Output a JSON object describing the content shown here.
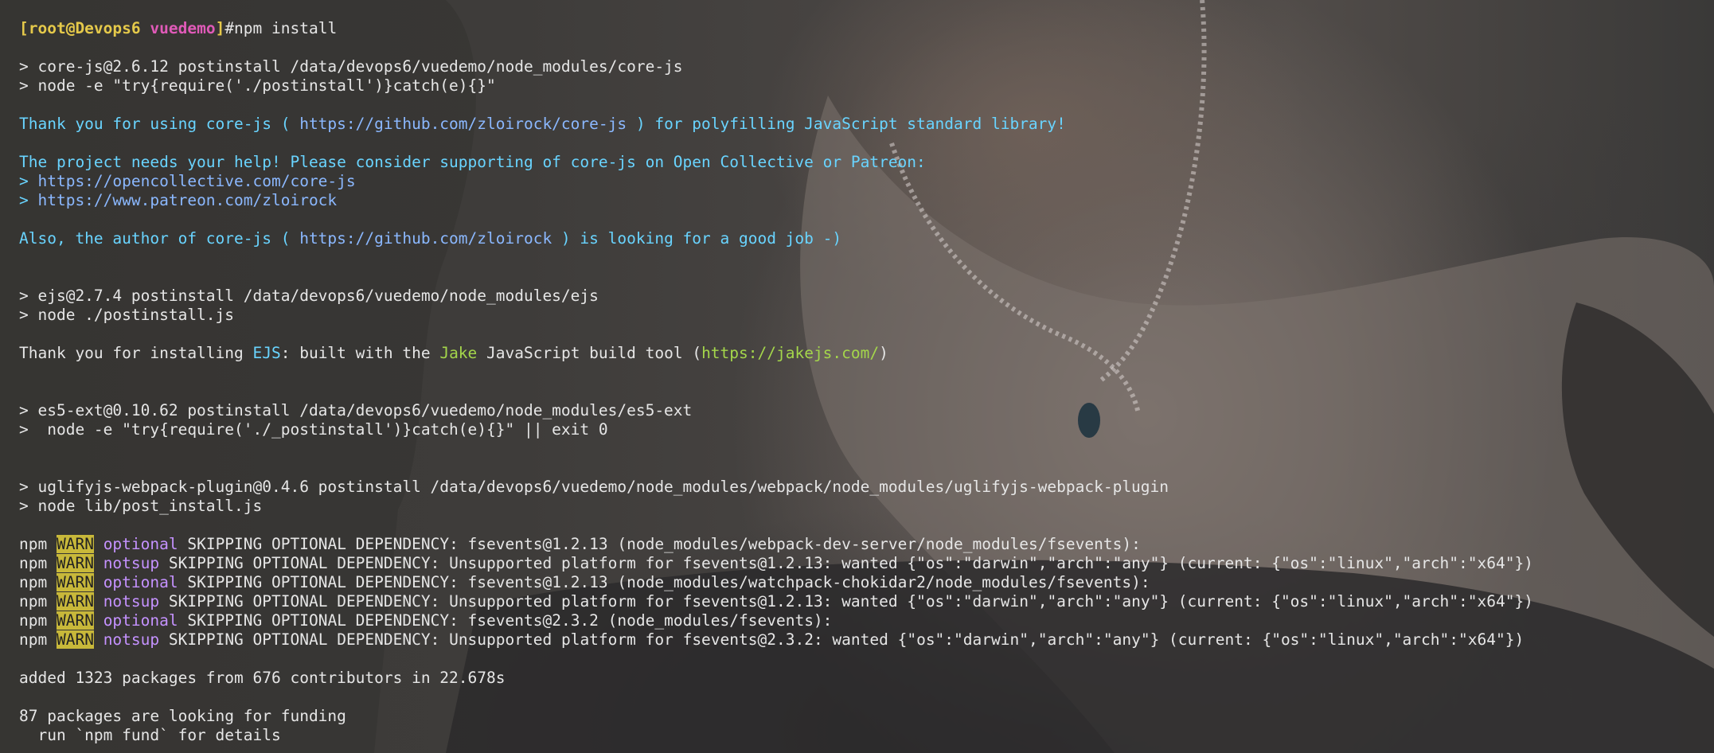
{
  "colors": {
    "prompt_user": "#e5c94a",
    "prompt_dir": "#e05ab8",
    "info_cyan": "#69d4ff",
    "link_blue": "#8bb8ff",
    "warn_bg": "#c8b83a",
    "optional_magenta": "#c592ff",
    "green": "#a4d64b",
    "default": "#e6e6e6"
  },
  "terminal": {
    "lines": [
      {
        "segments": []
      },
      {
        "segments": [
          {
            "cls": "t-bold-yellow",
            "text": "[root@Devops6 "
          },
          {
            "cls": "t-bold-pink",
            "text": "vuedemo"
          },
          {
            "cls": "t-bold-yellow",
            "text": "]"
          },
          {
            "cls": "t-default",
            "text": "#npm install"
          }
        ]
      },
      {
        "segments": []
      },
      {
        "segments": [
          {
            "cls": "t-default",
            "text": "> core-js@2.6.12 postinstall /data/devops6/vuedemo/node_modules/core-js"
          }
        ]
      },
      {
        "segments": [
          {
            "cls": "t-default",
            "text": "> node -e \"try{require('./postinstall')}catch(e){}\""
          }
        ]
      },
      {
        "segments": []
      },
      {
        "segments": [
          {
            "cls": "t-cyan",
            "text": "Thank you for using core-js ( "
          },
          {
            "cls": "t-blue-link",
            "text": "https://github.com/zloirock/core-js"
          },
          {
            "cls": "t-cyan",
            "text": " ) for polyfilling JavaScript standard library!"
          }
        ]
      },
      {
        "segments": []
      },
      {
        "segments": [
          {
            "cls": "t-cyan",
            "text": "The project needs your help! Please consider supporting of core-js on Open Collective or Patreon:"
          }
        ]
      },
      {
        "segments": [
          {
            "cls": "t-cyan",
            "text": "> "
          },
          {
            "cls": "t-blue-link",
            "text": "https://opencollective.com/core-js"
          }
        ]
      },
      {
        "segments": [
          {
            "cls": "t-cyan",
            "text": "> "
          },
          {
            "cls": "t-blue-link",
            "text": "https://www.patreon.com/zloirock"
          }
        ]
      },
      {
        "segments": []
      },
      {
        "segments": [
          {
            "cls": "t-cyan",
            "text": "Also, the author of core-js ( "
          },
          {
            "cls": "t-blue-link",
            "text": "https://github.com/zloirock"
          },
          {
            "cls": "t-cyan",
            "text": " ) is looking for a good job -)"
          }
        ]
      },
      {
        "segments": []
      },
      {
        "segments": []
      },
      {
        "segments": [
          {
            "cls": "t-default",
            "text": "> ejs@2.7.4 postinstall /data/devops6/vuedemo/node_modules/ejs"
          }
        ]
      },
      {
        "segments": [
          {
            "cls": "t-default",
            "text": "> node ./postinstall.js"
          }
        ]
      },
      {
        "segments": []
      },
      {
        "segments": [
          {
            "cls": "t-default",
            "text": "Thank you for installing "
          },
          {
            "cls": "t-cyan",
            "text": "EJS"
          },
          {
            "cls": "t-default",
            "text": ": built with the "
          },
          {
            "cls": "t-green",
            "text": "Jake"
          },
          {
            "cls": "t-default",
            "text": " JavaScript build tool ("
          },
          {
            "cls": "t-green",
            "text": "https://jakejs.com/"
          },
          {
            "cls": "t-default",
            "text": ")"
          }
        ]
      },
      {
        "segments": []
      },
      {
        "segments": []
      },
      {
        "segments": [
          {
            "cls": "t-default",
            "text": "> es5-ext@0.10.62 postinstall /data/devops6/vuedemo/node_modules/es5-ext"
          }
        ]
      },
      {
        "segments": [
          {
            "cls": "t-default",
            "text": ">  node -e \"try{require('./_postinstall')}catch(e){}\" || exit 0"
          }
        ]
      },
      {
        "segments": []
      },
      {
        "segments": []
      },
      {
        "segments": [
          {
            "cls": "t-default",
            "text": "> uglifyjs-webpack-plugin@0.4.6 postinstall /data/devops6/vuedemo/node_modules/webpack/node_modules/uglifyjs-webpack-plugin"
          }
        ]
      },
      {
        "segments": [
          {
            "cls": "t-default",
            "text": "> node lib/post_install.js"
          }
        ]
      },
      {
        "segments": []
      },
      {
        "segments": [
          {
            "cls": "t-default",
            "text": "npm "
          },
          {
            "cls": "t-warn",
            "text": "WARN"
          },
          {
            "cls": "t-default",
            "text": " "
          },
          {
            "cls": "t-magenta",
            "text": "optional"
          },
          {
            "cls": "t-default",
            "text": " SKIPPING OPTIONAL DEPENDENCY: fsevents@1.2.13 (node_modules/webpack-dev-server/node_modules/fsevents):"
          }
        ]
      },
      {
        "segments": [
          {
            "cls": "t-default",
            "text": "npm "
          },
          {
            "cls": "t-warn",
            "text": "WARN"
          },
          {
            "cls": "t-default",
            "text": " "
          },
          {
            "cls": "t-magenta",
            "text": "notsup"
          },
          {
            "cls": "t-default",
            "text": " SKIPPING OPTIONAL DEPENDENCY: Unsupported platform for fsevents@1.2.13: wanted {\"os\":\"darwin\",\"arch\":\"any\"} (current: {\"os\":\"linux\",\"arch\":\"x64\"})"
          }
        ]
      },
      {
        "segments": [
          {
            "cls": "t-default",
            "text": "npm "
          },
          {
            "cls": "t-warn",
            "text": "WARN"
          },
          {
            "cls": "t-default",
            "text": " "
          },
          {
            "cls": "t-magenta",
            "text": "optional"
          },
          {
            "cls": "t-default",
            "text": " SKIPPING OPTIONAL DEPENDENCY: fsevents@1.2.13 (node_modules/watchpack-chokidar2/node_modules/fsevents):"
          }
        ]
      },
      {
        "segments": [
          {
            "cls": "t-default",
            "text": "npm "
          },
          {
            "cls": "t-warn",
            "text": "WARN"
          },
          {
            "cls": "t-default",
            "text": " "
          },
          {
            "cls": "t-magenta",
            "text": "notsup"
          },
          {
            "cls": "t-default",
            "text": " SKIPPING OPTIONAL DEPENDENCY: Unsupported platform for fsevents@1.2.13: wanted {\"os\":\"darwin\",\"arch\":\"any\"} (current: {\"os\":\"linux\",\"arch\":\"x64\"})"
          }
        ]
      },
      {
        "segments": [
          {
            "cls": "t-default",
            "text": "npm "
          },
          {
            "cls": "t-warn",
            "text": "WARN"
          },
          {
            "cls": "t-default",
            "text": " "
          },
          {
            "cls": "t-magenta",
            "text": "optional"
          },
          {
            "cls": "t-default",
            "text": " SKIPPING OPTIONAL DEPENDENCY: fsevents@2.3.2 (node_modules/fsevents):"
          }
        ]
      },
      {
        "segments": [
          {
            "cls": "t-default",
            "text": "npm "
          },
          {
            "cls": "t-warn",
            "text": "WARN"
          },
          {
            "cls": "t-default",
            "text": " "
          },
          {
            "cls": "t-magenta",
            "text": "notsup"
          },
          {
            "cls": "t-default",
            "text": " SKIPPING OPTIONAL DEPENDENCY: Unsupported platform for fsevents@2.3.2: wanted {\"os\":\"darwin\",\"arch\":\"any\"} (current: {\"os\":\"linux\",\"arch\":\"x64\"})"
          }
        ]
      },
      {
        "segments": []
      },
      {
        "segments": [
          {
            "cls": "t-default",
            "text": "added 1323 packages from 676 contributors in 22.678s"
          }
        ]
      },
      {
        "segments": []
      },
      {
        "segments": [
          {
            "cls": "t-default",
            "text": "87 packages are looking for funding"
          }
        ]
      },
      {
        "segments": [
          {
            "cls": "t-default",
            "text": "  run `npm fund` for details"
          }
        ]
      },
      {
        "segments": []
      }
    ]
  }
}
